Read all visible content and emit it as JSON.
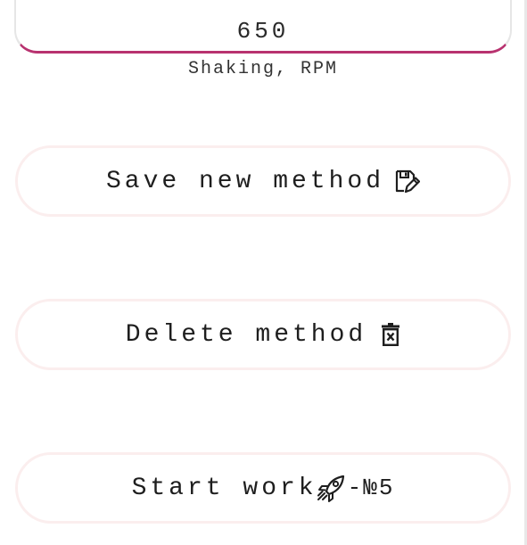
{
  "shaking": {
    "value": "650",
    "label": "Shaking, RPM",
    "accent_color": "#b8326f"
  },
  "buttons": {
    "save": {
      "label": "Save new method",
      "icon": "floppy-pencil-icon"
    },
    "delete": {
      "label": "Delete method",
      "icon": "trash-icon"
    },
    "start": {
      "label": "Start work",
      "icon": "rocket-icon",
      "suffix": "-№5"
    }
  }
}
